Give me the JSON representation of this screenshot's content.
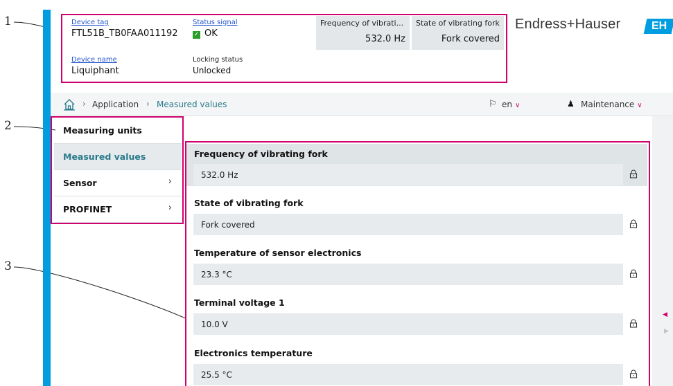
{
  "callouts": [
    "1",
    "2",
    "3"
  ],
  "header": {
    "device_tag_label": "Device tag",
    "device_tag_value": "FTL51B_TB0FAA011192",
    "status_label": "Status signal",
    "status_value": "OK",
    "device_name_label": "Device name",
    "device_name_value": "Liquiphant",
    "locking_label": "Locking status",
    "locking_value": "Unlocked",
    "box1_title": "Frequency of vibrati...",
    "box1_value": "532.0 Hz",
    "box2_title": "State of vibrating fork",
    "box2_value": "Fork covered",
    "brand": "Endress+Hauser",
    "logo_text": "EH"
  },
  "breadcrumb": {
    "items": [
      "Application",
      "Measured values"
    ],
    "language": "en",
    "role": "Maintenance"
  },
  "sidebar": {
    "items": [
      {
        "label": "Measuring units"
      },
      {
        "label": "Measured values"
      },
      {
        "label": "Sensor"
      },
      {
        "label": "PROFINET"
      }
    ]
  },
  "main": {
    "groups": [
      {
        "label": "Frequency of vibrating fork",
        "value": "532.0 Hz"
      },
      {
        "label": "State of vibrating fork",
        "value": "Fork covered"
      },
      {
        "label": "Temperature of sensor electronics",
        "value": "23.3 °C"
      },
      {
        "label": "Terminal voltage 1",
        "value": "10.0 V"
      },
      {
        "label": "Electronics temperature",
        "value": "25.5 °C"
      }
    ]
  },
  "colors": {
    "accent_blue": "#009ee0",
    "highlight_magenta": "#d0006f",
    "link_teal": "#2a7a8c",
    "status_ok_green": "#2a9d2a"
  },
  "icons": {
    "home": "home-icon",
    "flag": "flag-icon",
    "user": "user-icon",
    "lock": "lock-icon",
    "status": "check-icon"
  }
}
